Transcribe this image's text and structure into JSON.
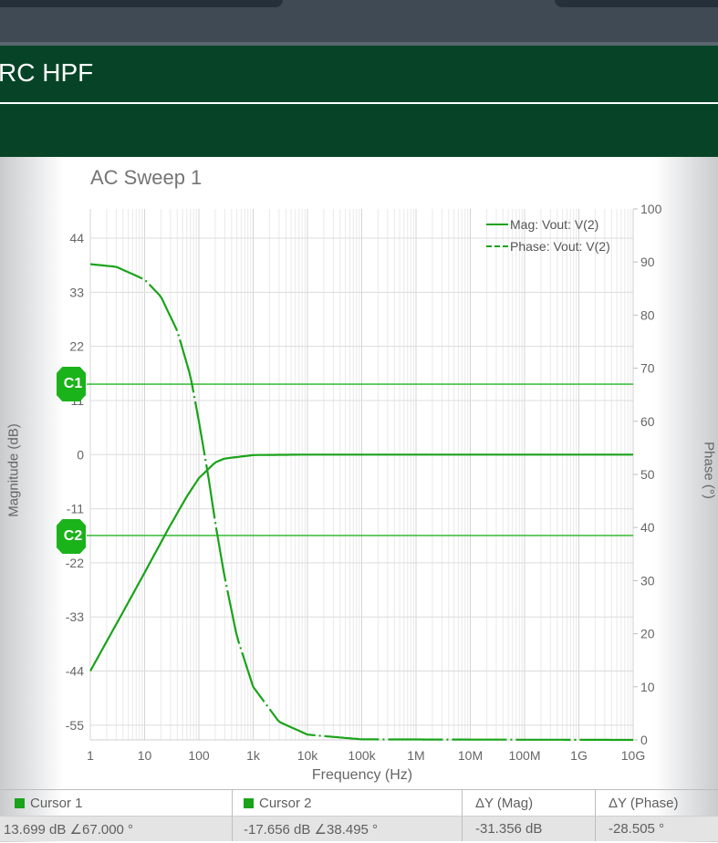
{
  "window": {
    "title": "RC HPF"
  },
  "chart_data": {
    "type": "line",
    "title": "AC Sweep 1",
    "xlabel": "Frequency (Hz)",
    "ylabel_left": "Magnitude (dB)",
    "ylabel_right": "Phase (°)",
    "xscale": "log",
    "xlim": [
      1,
      10000000000
    ],
    "xticks": [
      1,
      10,
      100,
      1000,
      10000,
      100000,
      1000000,
      10000000,
      100000000,
      1000000000,
      10000000000
    ],
    "xtick_labels": [
      "1",
      "10",
      "100",
      "1k",
      "10k",
      "100k",
      "1M",
      "10M",
      "100M",
      "1G",
      "10G"
    ],
    "ylim_left": [
      -60,
      46
    ],
    "yticks_left": [
      44,
      33,
      22,
      11,
      0,
      -11,
      -22,
      -33,
      -44,
      -55
    ],
    "ytick_labels_left": [
      "44",
      "33",
      "22",
      "11",
      "0",
      "-11",
      "-22",
      "-33",
      "-44",
      "-55"
    ],
    "ylim_right": [
      0,
      100
    ],
    "yticks_right": [
      100,
      90,
      80,
      70,
      60,
      50,
      40,
      30,
      20,
      10,
      0
    ],
    "ytick_labels_right": [
      "100",
      "90",
      "80",
      "70",
      "60",
      "50",
      "40",
      "30",
      "20",
      "10",
      "0"
    ],
    "grid": true,
    "legend_position": "top-right",
    "legend": [
      "Mag: Vout: V(2)",
      "Phase: Vout: V(2)"
    ],
    "series": [
      {
        "name": "Mag: Vout: V(2)",
        "axis": "left",
        "style": "solid",
        "x": [
          1,
          3,
          10,
          30,
          60,
          100,
          200,
          300,
          1000,
          10000,
          10000000000
        ],
        "y": [
          -44,
          -34.5,
          -24.0,
          -14.3,
          -8.5,
          -4.8,
          -1.6,
          -0.8,
          -0.1,
          0,
          0
        ]
      },
      {
        "name": "Phase: Vout: V(2)",
        "axis": "right",
        "style": "dash-dot",
        "x": [
          1,
          3,
          10,
          20,
          40,
          70,
          100,
          150,
          200,
          300,
          500,
          1000,
          3000,
          10000,
          100000,
          10000000000
        ],
        "y": [
          89.6,
          89.1,
          86.7,
          83.5,
          77.0,
          68.5,
          60.0,
          49.5,
          41.0,
          30.5,
          19.5,
          10.0,
          3.4,
          1.0,
          0.1,
          0
        ]
      }
    ],
    "cursors": [
      {
        "label": "C1",
        "mag_db": 13.699,
        "phase_deg": 67.0
      },
      {
        "label": "C2",
        "mag_db": -17.656,
        "phase_deg": 38.495
      }
    ]
  },
  "cursor_table": {
    "headers": [
      "Cursor 1",
      "Cursor 2",
      "ΔY (Mag)",
      "ΔY (Phase)"
    ],
    "values": [
      "13.699 dB ∠67.000 °",
      "-17.656 dB ∠38.495 °",
      "-31.356 dB",
      "-28.505 °"
    ]
  },
  "colors": {
    "series": "#1aa31a",
    "header": "#074427",
    "grid": "#dddddd",
    "cursor_tag": "#1ab31a"
  }
}
